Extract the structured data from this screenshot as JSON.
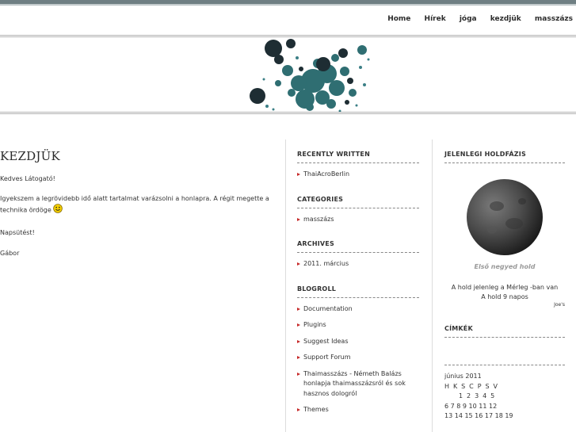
{
  "nav": [
    "Home",
    "Hírek",
    "jóga",
    "kezdjük",
    "masszázs"
  ],
  "post": {
    "title": "KEZDJÜK",
    "paragraphs": [
      "Kedves Látogató!",
      "Igyekszem a legrövidebb idő alatt tartalmat varázsolni a honlapra. A régit megette a technika ördöge",
      "Napsütést!",
      "Gábor"
    ]
  },
  "sidebar1": {
    "recent": {
      "title": "RECENTLY WRITTEN",
      "items": [
        "ThaiAcroBerlin"
      ]
    },
    "categories": {
      "title": "CATEGORIES",
      "items": [
        "masszázs"
      ]
    },
    "archives": {
      "title": "ARCHIVES",
      "items": [
        "2011. március"
      ]
    },
    "blogroll": {
      "title": "BLOGROLL",
      "items": [
        "Documentation",
        "Plugins",
        "Suggest Ideas",
        "Support Forum",
        "Thaimasszázs - Németh Balázs honlapja thaimasszázsról és sok hasznos dologról",
        "Themes"
      ]
    }
  },
  "sidebar2": {
    "moon": {
      "title": "JELENLEGI HOLDFÁZIS",
      "caption": "Első negyed hold",
      "line1": "A hold jelenleg a Mérleg -ban van",
      "line2": "A hold 9 napos",
      "credit": "Joe's"
    },
    "tags": {
      "title": "CÍMKÉK"
    },
    "calendar": {
      "month": "június 2011",
      "days_header": "H K S C P S V",
      "row1": "1 2 3 4 5",
      "row2": "6 7 8 9 10 11 12",
      "row3": "13 14 15 16 17 18 19"
    }
  }
}
